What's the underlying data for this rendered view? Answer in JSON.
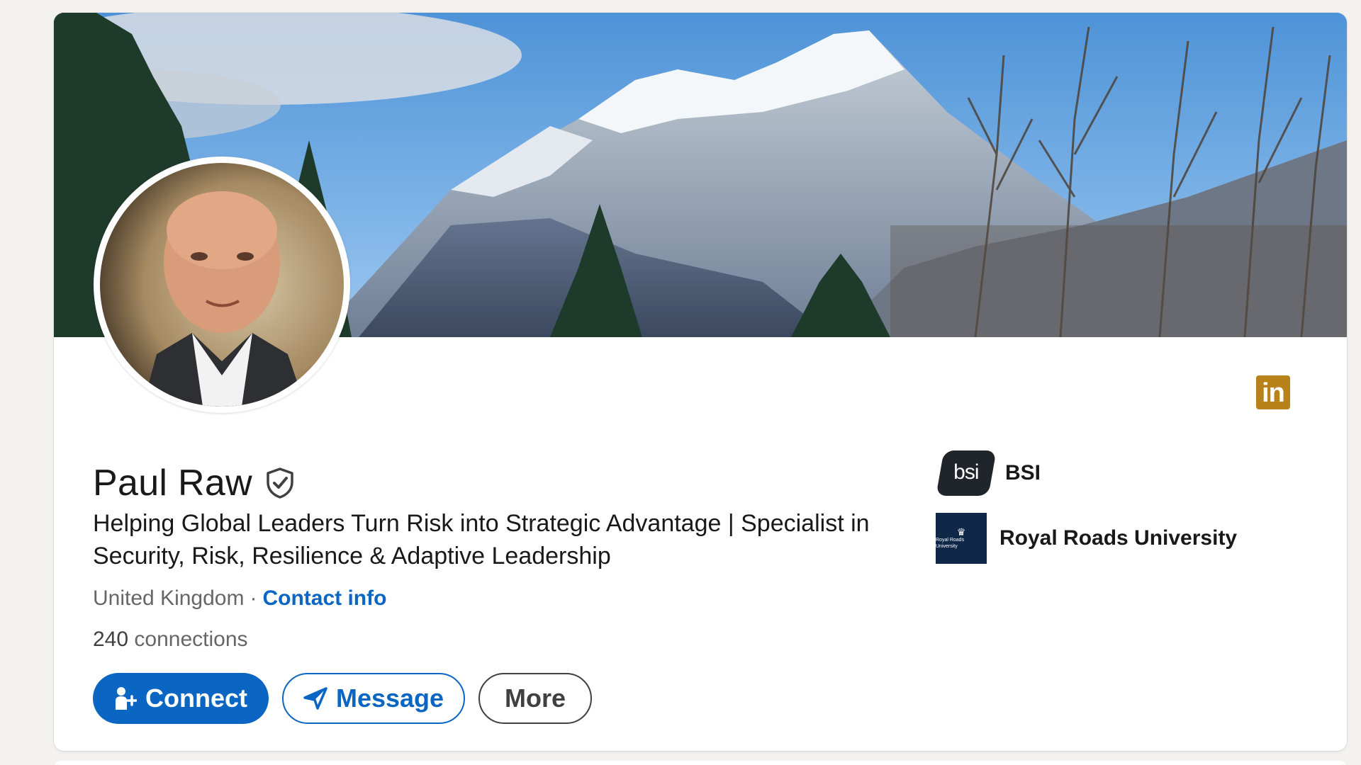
{
  "profile": {
    "name": "Paul Raw",
    "headline": "Helping Global Leaders Turn Risk into Strategic Advantage | Specialist in Security, Risk, Resilience & Adaptive Leadership",
    "location": "United Kingdom",
    "separator": "·",
    "contact_info_label": "Contact info",
    "connections_count": "240",
    "connections_label": "connections"
  },
  "badge": {
    "label": "in"
  },
  "actions": {
    "connect_label": "Connect",
    "message_label": "Message",
    "more_label": "More"
  },
  "organizations": [
    {
      "name": "BSI",
      "logo_text": "bsi",
      "icon": "bsi-logo"
    },
    {
      "name": "Royal Roads University",
      "logo_text": "Royal Roads University",
      "icon": "royal-roads-logo"
    }
  ],
  "icons": {
    "verified": "shield-check-icon",
    "connect": "person-add-icon",
    "message": "send-icon"
  },
  "colors": {
    "primary_blue": "#0a66c2",
    "page_background": "#f3f2ef",
    "linkedin_badge": "#b8821a",
    "text_dark": "#191919",
    "text_muted": "#666666"
  }
}
